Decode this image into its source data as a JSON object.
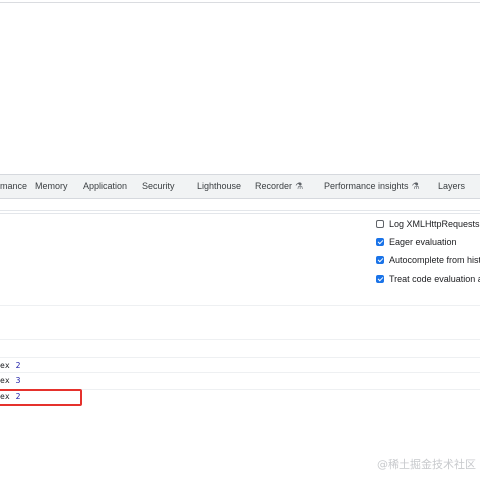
{
  "devtools": {
    "tabs": [
      {
        "label": "mance",
        "experimental": false
      },
      {
        "label": "Memory",
        "experimental": false
      },
      {
        "label": "Application",
        "experimental": false
      },
      {
        "label": "Security",
        "experimental": false
      },
      {
        "label": "Lighthouse",
        "experimental": false
      },
      {
        "label": "Recorder",
        "experimental": true
      },
      {
        "label": "Performance insights",
        "experimental": true
      },
      {
        "label": "Layers",
        "experimental": false
      }
    ],
    "flask_glyph": "⚗"
  },
  "console_settings": [
    {
      "label": "Log XMLHttpRequests",
      "checked": false
    },
    {
      "label": "Eager evaluation",
      "checked": true
    },
    {
      "label": "Autocomplete from histo",
      "checked": true
    },
    {
      "label": "Treat code evaluation as",
      "checked": true
    }
  ],
  "console_rows": [
    {
      "text": "ex",
      "value": "2"
    },
    {
      "text": "ex",
      "value": "3"
    },
    {
      "text": "ex",
      "value": "2"
    }
  ],
  "highlight_color": "#e5312c",
  "accent_color": "#1a73e8",
  "watermark": "@稀土掘金技术社区"
}
